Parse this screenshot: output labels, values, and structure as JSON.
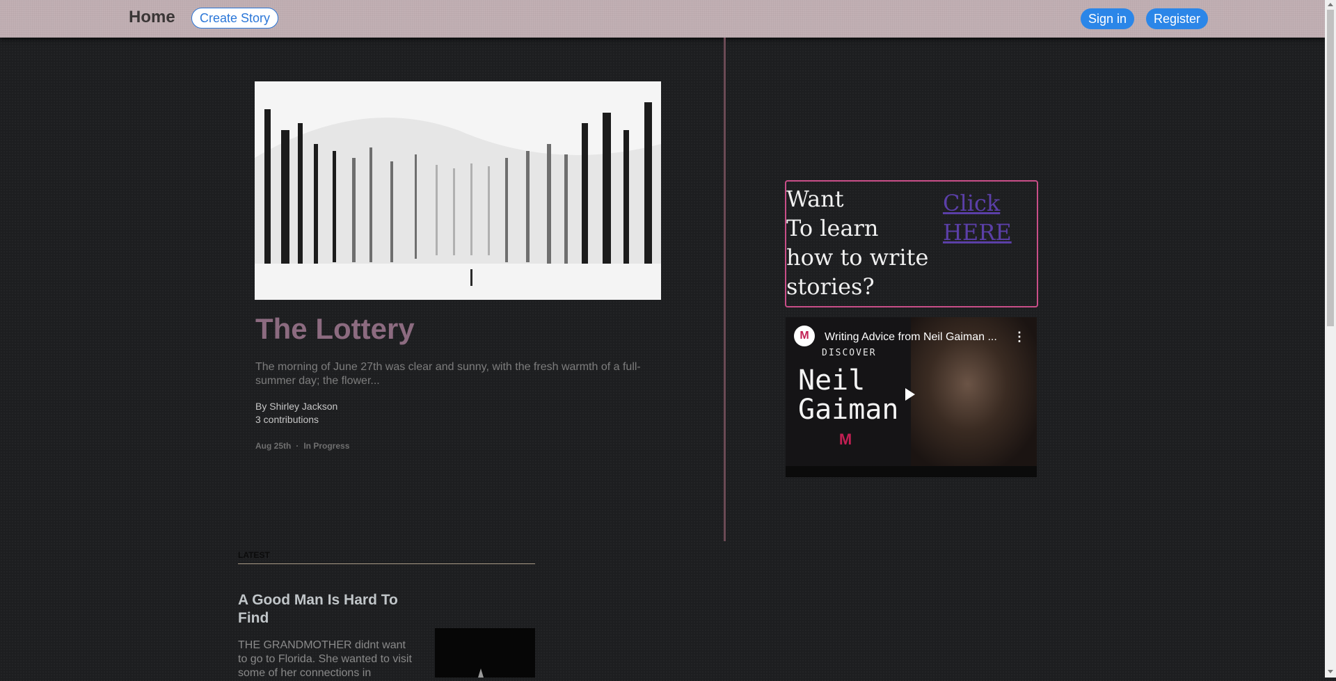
{
  "nav": {
    "brand": "Home",
    "create_story": "Create Story",
    "sign_in": "Sign in",
    "register": "Register"
  },
  "featured": {
    "image_icon": "snowy-forest-image",
    "title": "The Lottery",
    "excerpt": "The morning of June 27th was clear and sunny, with the fresh warmth of a full-summer day; the flower...",
    "author": "By Shirley Jackson",
    "contributions": "3 contributions",
    "date": "Aug 25th",
    "separator": "·",
    "status": "In Progress"
  },
  "promo": {
    "text_lines": [
      "Want",
      "To learn",
      "how to write",
      "stories?"
    ],
    "link_lines": [
      "Click",
      "HERE"
    ]
  },
  "video": {
    "channel_logo": "M",
    "title": "Writing Advice from Neil Gaiman ...",
    "menu": "⋮",
    "discover": "DISCOVER",
    "name_lines": [
      "Neil",
      "Gaiman"
    ],
    "brand_mark": "M",
    "play_icon": "play-icon"
  },
  "latest": {
    "label": "LATEST",
    "items": [
      {
        "title": "A Good Man Is Hard To Find",
        "excerpt": "THE GRANDMOTHER didnt want to go to Florida. She wanted to visit some of her connections in"
      }
    ]
  },
  "colors": {
    "accent": "#2b86e8",
    "title_mauve": "#8c6b80",
    "promo_border": "#c94e88",
    "navbar": "#c2b0b4"
  }
}
